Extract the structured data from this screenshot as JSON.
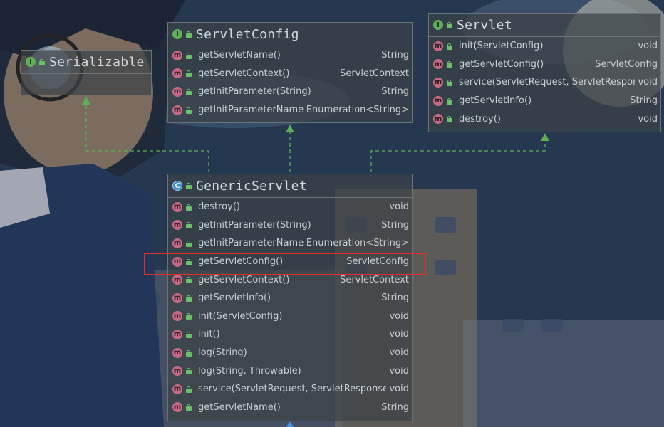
{
  "colors": {
    "interface_icon": "#5fae5a",
    "class_icon": "#3d8fc8",
    "method_icon": "#c46a86",
    "edge": "#5fae5a",
    "highlight": "#e0302c"
  },
  "serializable": {
    "title": "Serializable",
    "kind": "I"
  },
  "servlet_config": {
    "title": "ServletConfig",
    "kind": "I",
    "methods": [
      {
        "name": "getServletName()",
        "type": "String"
      },
      {
        "name": "getServletContext()",
        "type": "ServletContext"
      },
      {
        "name": "getInitParameter(String)",
        "type": "String"
      },
      {
        "name": "getInitParameterNames()",
        "type": "Enumeration<String>"
      }
    ]
  },
  "servlet": {
    "title": "Servlet",
    "kind": "I",
    "methods": [
      {
        "name": "init(ServletConfig)",
        "type": "void"
      },
      {
        "name": "getServletConfig()",
        "type": "ServletConfig"
      },
      {
        "name": "service(ServletRequest, ServletResponse)",
        "type": "void"
      },
      {
        "name": "getServletInfo()",
        "type": "String"
      },
      {
        "name": "destroy()",
        "type": "void"
      }
    ]
  },
  "generic_servlet": {
    "title": "GenericServlet",
    "kind": "C",
    "methods": [
      {
        "name": "destroy()",
        "type": "void"
      },
      {
        "name": "getInitParameter(String)",
        "type": "String"
      },
      {
        "name": "getInitParameterNames()",
        "type": "Enumeration<String>"
      },
      {
        "name": "getServletConfig()",
        "type": "ServletConfig"
      },
      {
        "name": "getServletContext()",
        "type": "ServletContext"
      },
      {
        "name": "getServletInfo()",
        "type": "String"
      },
      {
        "name": "init(ServletConfig)",
        "type": "void"
      },
      {
        "name": "init()",
        "type": "void"
      },
      {
        "name": "log(String)",
        "type": "void"
      },
      {
        "name": "log(String, Throwable)",
        "type": "void"
      },
      {
        "name": "service(ServletRequest, ServletResponse)",
        "type": "void"
      },
      {
        "name": "getServletName()",
        "type": "String"
      }
    ]
  },
  "method_icon_letter": "m"
}
